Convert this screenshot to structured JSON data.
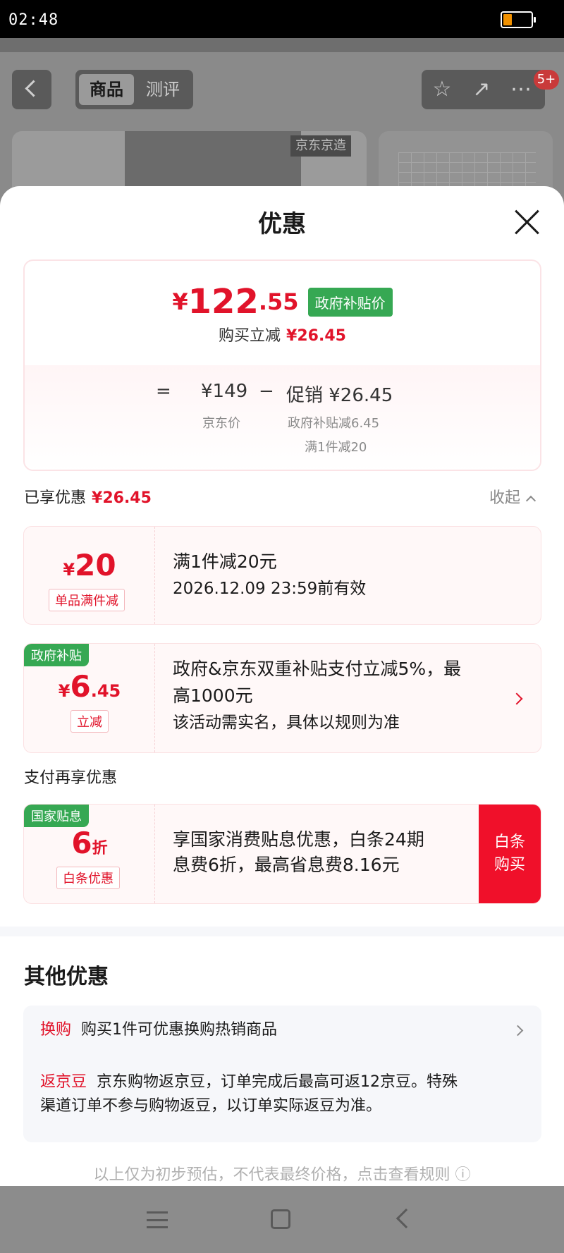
{
  "status_bar": {
    "time": "02:48"
  },
  "background_page": {
    "tabs": [
      "商品",
      "测评"
    ],
    "badge": "5+",
    "brand_tag": "京东京造"
  },
  "sheet": {
    "title": "优惠",
    "price": {
      "yen": "¥",
      "integer": "122",
      "decimal": ".55",
      "badge": "政府补贴价",
      "discount_label": "购买立减",
      "discount_value": "¥26.45"
    },
    "formula": {
      "equals": "=",
      "base_price": "¥149",
      "minus": "−",
      "promo": "促销 ¥26.45",
      "base_label": "京东价",
      "promo_detail_1": "政府补贴减6.45",
      "promo_detail_2": "满1件减20"
    },
    "enjoyed": {
      "label": "已享优惠",
      "value": "¥26.45",
      "collapse": "收起"
    },
    "coupons": [
      {
        "yen": "¥",
        "amount": "20",
        "tag": "单品满件减",
        "line1": "满1件减20元",
        "line2": "2026.12.09 23:59前有效"
      },
      {
        "corner": "政府补贴",
        "yen": "¥",
        "amount_int": "6",
        "amount_dec": ".45",
        "tag": "立减",
        "line1": "政府&京东双重补贴支付立减5%，最",
        "line2": "高1000元",
        "line3": "该活动需实名，具体以规则为准"
      }
    ],
    "pay_title": "支付再享优惠",
    "pay_coupon": {
      "corner": "国家贴息",
      "amount": "6",
      "unit": "折",
      "tag": "白条优惠",
      "line1": "享国家消费贴息优惠，白条24期",
      "line2": "息费6折，最高省息费8.16元",
      "button_line1": "白条",
      "button_line2": "购买"
    },
    "other": {
      "title": "其他优惠",
      "rows": [
        {
          "keyword": "换购",
          "text": "购买1件可优惠换购热销商品"
        },
        {
          "keyword": "返京豆",
          "text": "京东购物返京豆，订单完成后最高可返12京豆。特殊",
          "text2": "渠道订单不参与购物返豆，以订单实际返豆为准。"
        }
      ]
    },
    "disclaimer": "以上仅为初步预估，不代表最终价格，点击查看规则 ⓘ"
  },
  "colors": {
    "accent_red": "#e1132a",
    "green_badge": "#36a853",
    "buy_button": "#f0102a"
  }
}
